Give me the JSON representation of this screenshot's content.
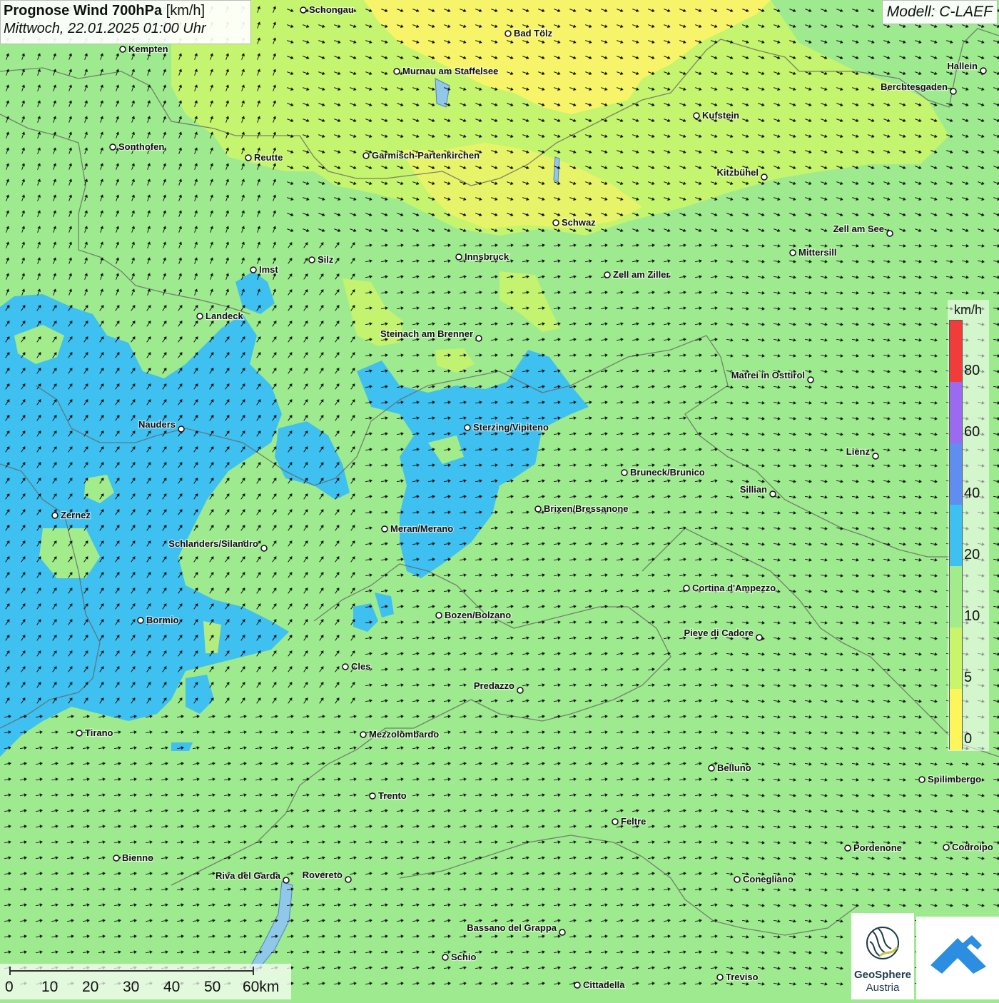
{
  "header": {
    "title_bold": "Prognose Wind 700hPa",
    "title_unit": "[km/h]",
    "datetime": "Mittwoch, 22.01.2025 01:00 Uhr",
    "model": "Modell: C-LAEF"
  },
  "legend": {
    "unit": "km/h",
    "ticks": [
      "0",
      "5",
      "10",
      "20",
      "40",
      "60",
      "80"
    ],
    "colors": [
      "#fdf65a",
      "#c9f56a",
      "#a3ec8c",
      "#3ec0f0",
      "#5f8ef0",
      "#9a6af0",
      "#f23c3c"
    ]
  },
  "scale_bar": {
    "labels": [
      "0",
      "10",
      "20",
      "30",
      "40",
      "50",
      "60km"
    ]
  },
  "logos": {
    "geosphere_name": "GeoSphere",
    "geosphere_sub": "Austria"
  },
  "cities": [
    {
      "name": "Schongau"
    },
    {
      "name": "Bad Tölz"
    },
    {
      "name": "Kempten"
    },
    {
      "name": "Murnau am Staffelsee"
    },
    {
      "name": "Hallein"
    },
    {
      "name": "Berchtesgaden"
    },
    {
      "name": "Kufstein"
    },
    {
      "name": "Sonthofen"
    },
    {
      "name": "Reutte"
    },
    {
      "name": "Garmisch-Partenkirchen"
    },
    {
      "name": "Kitzbühel"
    },
    {
      "name": "Schwaz"
    },
    {
      "name": "Zell am See"
    },
    {
      "name": "Mittersill"
    },
    {
      "name": "Innsbruck"
    },
    {
      "name": "Silz"
    },
    {
      "name": "Imst"
    },
    {
      "name": "Zell am Ziller"
    },
    {
      "name": "Landeck"
    },
    {
      "name": "Steinach am Brenner"
    },
    {
      "name": "Matrei in Osttirol"
    },
    {
      "name": "Nauders"
    },
    {
      "name": "Sterzing/Vipiteno"
    },
    {
      "name": "Lienz"
    },
    {
      "name": "Bruneck/Brunico"
    },
    {
      "name": "Sillian"
    },
    {
      "name": "Brixen/Bressanone"
    },
    {
      "name": "Zernez"
    },
    {
      "name": "Meran/Merano"
    },
    {
      "name": "Schlanders/Silandro"
    },
    {
      "name": "Cortina d'Ampezzo"
    },
    {
      "name": "Bozen/Bolzano"
    },
    {
      "name": "Bormio"
    },
    {
      "name": "Pieve di Cadore"
    },
    {
      "name": "Cles"
    },
    {
      "name": "Predazzo"
    },
    {
      "name": "Tirano"
    },
    {
      "name": "Mezzolombardo"
    },
    {
      "name": "Belluno"
    },
    {
      "name": "Spilimbergo"
    },
    {
      "name": "Trento"
    },
    {
      "name": "Feltre"
    },
    {
      "name": "Bienno"
    },
    {
      "name": "Pordenone"
    },
    {
      "name": "Codroipo"
    },
    {
      "name": "Riva del Garda"
    },
    {
      "name": "Rovereto"
    },
    {
      "name": "Conegliano"
    },
    {
      "name": "Bassano del Grappa"
    },
    {
      "name": "Schio"
    },
    {
      "name": "Treviso"
    },
    {
      "name": "Cittadella"
    }
  ]
}
